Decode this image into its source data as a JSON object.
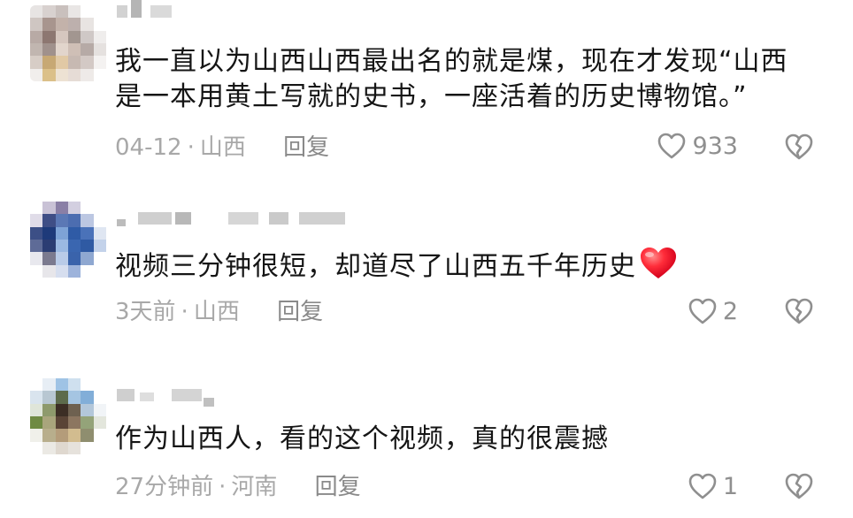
{
  "comments": [
    {
      "text_lines": [
        "我一直以为山西山西最出名的就是煤，现在才发现“山西",
        "是一本用黄土写就的史书，一座活着的历史博物馆。”"
      ],
      "time": "04-12",
      "location": "山西",
      "reply_label": "回复",
      "likes": "933",
      "icons": [
        "like-heart-icon",
        "dislike-broken-heart-icon"
      ]
    },
    {
      "text_lines": [
        "视频三分钟很短，却道尽了山西五千年历史"
      ],
      "emoji": "red-heart-emoji",
      "time": "3天前",
      "location": "山西",
      "reply_label": "回复",
      "likes": "2",
      "icons": [
        "like-heart-icon",
        "dislike-broken-heart-icon"
      ]
    },
    {
      "text_lines": [
        "作为山西人，看的这个视频，真的很震撼"
      ],
      "time": "27分钟前",
      "location": "河南",
      "reply_label": "回复",
      "likes": "1",
      "icons": [
        "like-heart-icon",
        "dislike-broken-heart-icon"
      ]
    }
  ],
  "separator": "·",
  "colors": {
    "text": "#151515",
    "meta": "#a8a8a8",
    "icon": "#8f8f8f",
    "heart": "#ff2d55"
  }
}
